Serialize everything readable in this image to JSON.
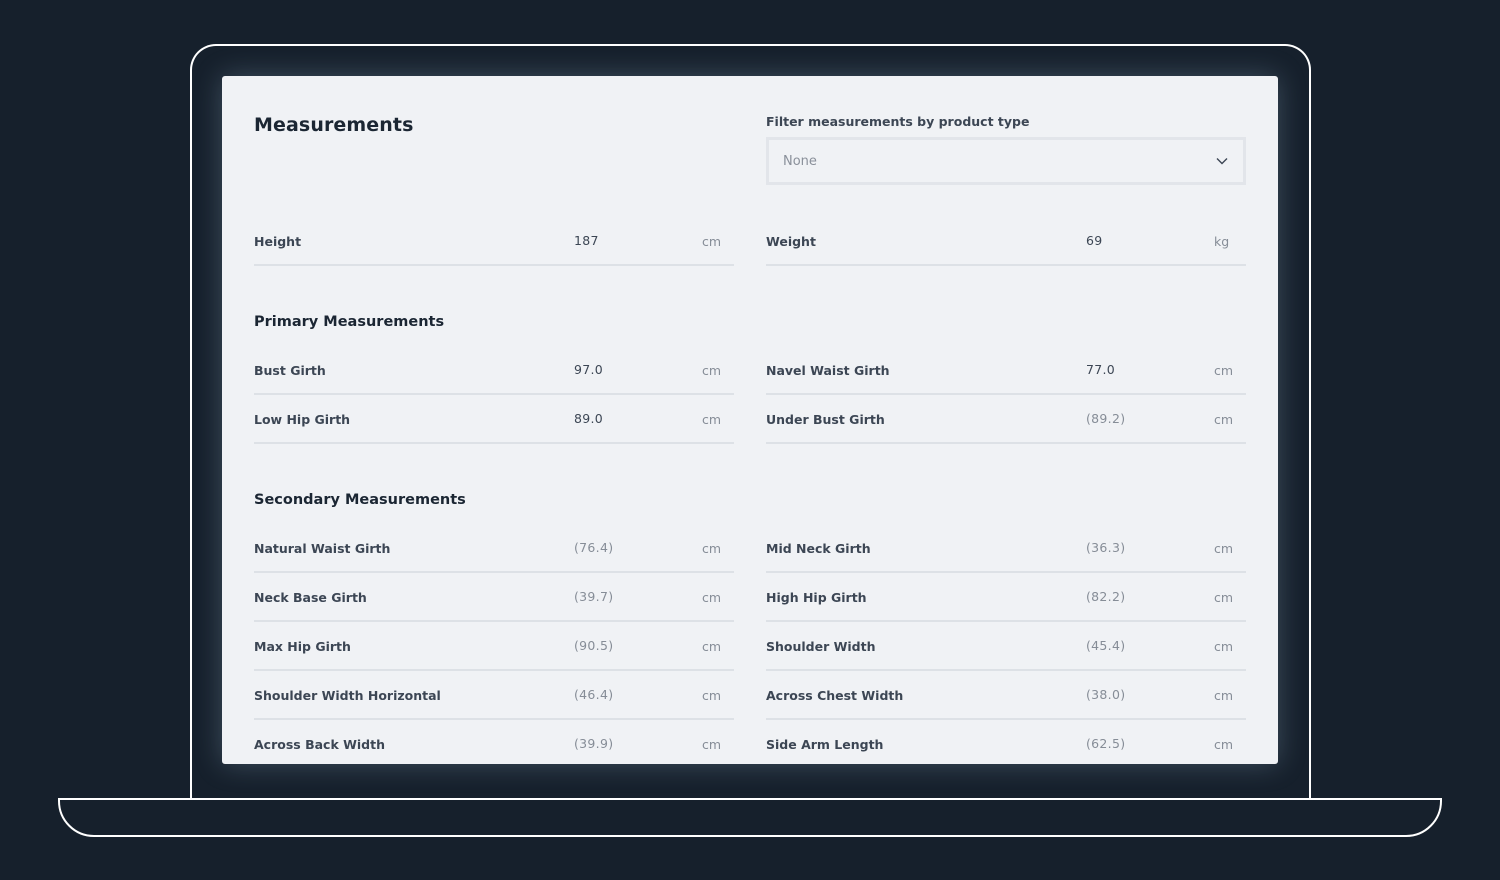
{
  "header": {
    "title": "Measurements",
    "filter_label": "Filter measurements by product type",
    "filter_value": "None"
  },
  "basic": {
    "height": {
      "label": "Height",
      "value": "187",
      "unit": "cm"
    },
    "weight": {
      "label": "Weight",
      "value": "69",
      "unit": "kg"
    }
  },
  "primary": {
    "title": "Primary Measurements",
    "left": [
      {
        "label": "Bust Girth",
        "value": "97.0",
        "unit": "cm"
      },
      {
        "label": "Low Hip Girth",
        "value": "89.0",
        "unit": "cm"
      }
    ],
    "right": [
      {
        "label": "Navel Waist Girth",
        "value": "77.0",
        "unit": "cm"
      },
      {
        "label": "Under Bust Girth",
        "value": "(89.2)",
        "unit": "cm"
      }
    ]
  },
  "secondary": {
    "title": "Secondary Measurements",
    "left": [
      {
        "label": "Natural Waist Girth",
        "value": "(76.4)",
        "unit": "cm"
      },
      {
        "label": "Neck Base Girth",
        "value": "(39.7)",
        "unit": "cm"
      },
      {
        "label": "Max Hip Girth",
        "value": "(90.5)",
        "unit": "cm"
      },
      {
        "label": "Shoulder Width Horizontal",
        "value": "(46.4)",
        "unit": "cm"
      },
      {
        "label": "Across Back Width",
        "value": "(39.9)",
        "unit": "cm"
      }
    ],
    "right": [
      {
        "label": "Mid Neck Girth",
        "value": "(36.3)",
        "unit": "cm"
      },
      {
        "label": "High Hip Girth",
        "value": "(82.2)",
        "unit": "cm"
      },
      {
        "label": "Shoulder Width",
        "value": "(45.4)",
        "unit": "cm"
      },
      {
        "label": "Across Chest Width",
        "value": "(38.0)",
        "unit": "cm"
      },
      {
        "label": "Side Arm Length",
        "value": "(62.5)",
        "unit": "cm"
      }
    ]
  },
  "colors": {
    "background": "#16202c",
    "panel": "#f0f2f5",
    "text_dark": "#1b2633",
    "text_label": "#3c4654",
    "text_muted": "#868d97",
    "divider": "#dde1e6"
  },
  "icons": {
    "dropdown": "chevron-down-icon"
  }
}
